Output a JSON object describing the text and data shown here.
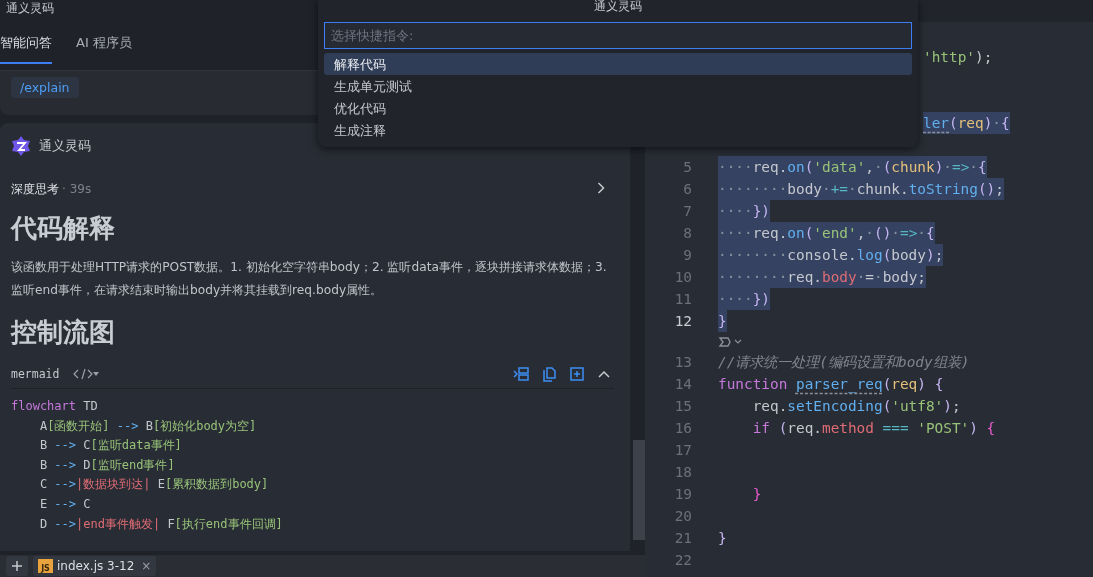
{
  "left_panel": {
    "title": "通义灵码",
    "tabs": [
      {
        "label": "智能问答",
        "selected": true
      },
      {
        "label": "AI 程序员",
        "selected": false
      }
    ],
    "prompt_chip": "/explain",
    "response": {
      "author": "通义灵码",
      "thinking": {
        "label": "深度思考",
        "duration": "· 39s"
      },
      "sections": [
        {
          "kind": "heading",
          "text": "代码解释"
        },
        {
          "kind": "paragraph",
          "text": "该函数用于处理HTTP请求的POST数据。1. 初始化空字符串body；2. 监听data事件，逐块拼接请求体数据；3. 监听end事件，在请求结束时输出body并将其挂载到req.body属性。"
        },
        {
          "kind": "heading",
          "text": "控制流图"
        }
      ],
      "code_block": {
        "language": "mermaid",
        "lines": [
          [
            {
              "text": "flowchart",
              "kind": "kw"
            },
            {
              "text": " TD",
              "kind": "plain"
            }
          ],
          [
            {
              "text": "    A",
              "kind": "plain"
            },
            {
              "text": "[函数开始]",
              "kind": "node"
            },
            {
              "text": " --> ",
              "kind": "arrow"
            },
            {
              "text": "B",
              "kind": "plain"
            },
            {
              "text": "[初始化body为空]",
              "kind": "node"
            }
          ],
          [
            {
              "text": "    B",
              "kind": "plain"
            },
            {
              "text": " --> ",
              "kind": "arrow"
            },
            {
              "text": "C",
              "kind": "plain"
            },
            {
              "text": "[监听data事件]",
              "kind": "node"
            }
          ],
          [
            {
              "text": "    B",
              "kind": "plain"
            },
            {
              "text": " --> ",
              "kind": "arrow"
            },
            {
              "text": "D",
              "kind": "plain"
            },
            {
              "text": "[监听end事件]",
              "kind": "node"
            }
          ],
          [
            {
              "text": "    C",
              "kind": "plain"
            },
            {
              "text": " -->",
              "kind": "arrow"
            },
            {
              "text": "|数据块到达|",
              "kind": "label"
            },
            {
              "text": " E",
              "kind": "plain"
            },
            {
              "text": "[累积数据到body]",
              "kind": "node"
            }
          ],
          [
            {
              "text": "    E",
              "kind": "plain"
            },
            {
              "text": " --> ",
              "kind": "arrow"
            },
            {
              "text": "C",
              "kind": "plain"
            }
          ],
          [
            {
              "text": "    D",
              "kind": "plain"
            },
            {
              "text": " -->",
              "kind": "arrow"
            },
            {
              "text": "|end事件触发|",
              "kind": "label"
            },
            {
              "text": " F",
              "kind": "plain"
            },
            {
              "text": "[执行end事件回调]",
              "kind": "node"
            }
          ]
        ]
      }
    },
    "bottom_tab": {
      "file_icon_label": "JS",
      "label": "index.js 3-12",
      "close": "×"
    }
  },
  "command_palette": {
    "title": "通义灵码",
    "placeholder": "选择快捷指令:",
    "items": [
      {
        "label": "解释代码",
        "selected": true
      },
      {
        "label": "生成单元测试",
        "selected": false
      },
      {
        "label": "优化代码",
        "selected": false
      },
      {
        "label": "生成注释",
        "selected": false
      }
    ]
  },
  "editor": {
    "rows": [
      {
        "kind": "partial",
        "selected": false,
        "tokens": [
          {
            "text": "'http'",
            "kind": "str"
          },
          {
            "text": ");",
            "kind": "plain"
          }
        ]
      },
      {
        "kind": "blank"
      },
      {
        "kind": "blank"
      },
      {
        "kind": "partial",
        "selected": true,
        "tokens": [
          {
            "text": "ler",
            "kind": "fndef"
          },
          {
            "text": "(",
            "kind": "bracket"
          },
          {
            "text": "req",
            "kind": "param"
          },
          {
            "text": ")",
            "kind": "bracket"
          },
          {
            "text": "·",
            "kind": "ws"
          },
          {
            "text": "{",
            "kind": "bracket"
          }
        ]
      },
      {
        "kind": "blank"
      },
      {
        "kind": "code",
        "number": "5",
        "selected": true,
        "current": false,
        "tokens": [
          {
            "text": "····",
            "kind": "ws"
          },
          {
            "text": "req.",
            "kind": "plain"
          },
          {
            "text": "on",
            "kind": "fn"
          },
          {
            "text": "(",
            "kind": "bracket"
          },
          {
            "text": "'data'",
            "kind": "str"
          },
          {
            "text": ",",
            "kind": "plain"
          },
          {
            "text": "·",
            "kind": "ws"
          },
          {
            "text": "(",
            "kind": "bracket"
          },
          {
            "text": "chunk",
            "kind": "param"
          },
          {
            "text": ")",
            "kind": "bracket"
          },
          {
            "text": "·",
            "kind": "ws"
          },
          {
            "text": "=>",
            "kind": "op"
          },
          {
            "text": "·",
            "kind": "ws"
          },
          {
            "text": "{",
            "kind": "bracket"
          }
        ]
      },
      {
        "kind": "code",
        "number": "6",
        "selected": true,
        "current": false,
        "tokens": [
          {
            "text": "········",
            "kind": "ws"
          },
          {
            "text": "body",
            "kind": "plain"
          },
          {
            "text": "·",
            "kind": "ws"
          },
          {
            "text": "+=",
            "kind": "op"
          },
          {
            "text": "·",
            "kind": "ws"
          },
          {
            "text": "chunk.",
            "kind": "plain"
          },
          {
            "text": "toString",
            "kind": "fn"
          },
          {
            "text": "()",
            "kind": "bracket"
          },
          {
            "text": ";",
            "kind": "plain"
          }
        ]
      },
      {
        "kind": "code",
        "number": "7",
        "selected": true,
        "current": false,
        "tokens": [
          {
            "text": "····",
            "kind": "ws"
          },
          {
            "text": "})",
            "kind": "bracket"
          }
        ]
      },
      {
        "kind": "code",
        "number": "8",
        "selected": true,
        "current": false,
        "tokens": [
          {
            "text": "····",
            "kind": "ws"
          },
          {
            "text": "req.",
            "kind": "plain"
          },
          {
            "text": "on",
            "kind": "fn"
          },
          {
            "text": "(",
            "kind": "bracket"
          },
          {
            "text": "'end'",
            "kind": "str"
          },
          {
            "text": ",",
            "kind": "plain"
          },
          {
            "text": "·",
            "kind": "ws"
          },
          {
            "text": "()",
            "kind": "bracket"
          },
          {
            "text": "·",
            "kind": "ws"
          },
          {
            "text": "=>",
            "kind": "op"
          },
          {
            "text": "·",
            "kind": "ws"
          },
          {
            "text": "{",
            "kind": "bracket"
          }
        ]
      },
      {
        "kind": "code",
        "number": "9",
        "selected": true,
        "current": false,
        "tokens": [
          {
            "text": "········",
            "kind": "ws"
          },
          {
            "text": "console.",
            "kind": "plain"
          },
          {
            "text": "log",
            "kind": "fn"
          },
          {
            "text": "(",
            "kind": "bracket"
          },
          {
            "text": "body",
            "kind": "plain"
          },
          {
            "text": ")",
            "kind": "bracket"
          },
          {
            "text": ";",
            "kind": "plain"
          }
        ]
      },
      {
        "kind": "code",
        "number": "10",
        "selected": true,
        "current": false,
        "tokens": [
          {
            "text": "········",
            "kind": "ws"
          },
          {
            "text": "req.",
            "kind": "plain"
          },
          {
            "text": "body",
            "kind": "prop"
          },
          {
            "text": "·",
            "kind": "ws"
          },
          {
            "text": "=",
            "kind": "plain"
          },
          {
            "text": "·",
            "kind": "ws"
          },
          {
            "text": "body;",
            "kind": "plain"
          }
        ]
      },
      {
        "kind": "code",
        "number": "11",
        "selected": true,
        "current": false,
        "tokens": [
          {
            "text": "····",
            "kind": "ws"
          },
          {
            "text": "})",
            "kind": "bracket"
          }
        ]
      },
      {
        "kind": "code",
        "number": "12",
        "selected": true,
        "current": true,
        "tokens": [
          {
            "text": "}",
            "kind": "bracket"
          }
        ]
      },
      {
        "kind": "fold"
      },
      {
        "kind": "code",
        "number": "13",
        "selected": false,
        "current": false,
        "tokens": [
          {
            "text": "//请求统一处理(编码设置和body组装)",
            "kind": "comment"
          }
        ]
      },
      {
        "kind": "code",
        "number": "14",
        "selected": false,
        "current": false,
        "tokens": [
          {
            "text": "function ",
            "kind": "kw"
          },
          {
            "text": "parser_req",
            "kind": "fndef"
          },
          {
            "text": "(",
            "kind": "bracket"
          },
          {
            "text": "req",
            "kind": "param"
          },
          {
            "text": ")",
            "kind": "bracket"
          },
          {
            "text": " {",
            "kind": "bracket"
          }
        ]
      },
      {
        "kind": "code",
        "number": "15",
        "selected": false,
        "current": false,
        "tokens": [
          {
            "text": "    req.",
            "kind": "plain"
          },
          {
            "text": "setEncoding",
            "kind": "fn"
          },
          {
            "text": "(",
            "kind": "bracket"
          },
          {
            "text": "'utf8'",
            "kind": "str"
          },
          {
            "text": ")",
            "kind": "bracket"
          },
          {
            "text": ";",
            "kind": "plain"
          }
        ]
      },
      {
        "kind": "code",
        "number": "16",
        "selected": false,
        "current": false,
        "tokens": [
          {
            "text": "    if",
            "kind": "kw"
          },
          {
            "text": " (",
            "kind": "bracket"
          },
          {
            "text": "req.",
            "kind": "plain"
          },
          {
            "text": "method",
            "kind": "prop"
          },
          {
            "text": " ===",
            "kind": "op"
          },
          {
            "text": " 'POST'",
            "kind": "str"
          },
          {
            "text": ")",
            "kind": "bracket"
          },
          {
            "text": " {",
            "kind": "brace2"
          }
        ]
      },
      {
        "kind": "code",
        "number": "17",
        "current": false,
        "tokens": []
      },
      {
        "kind": "code",
        "number": "18",
        "current": false,
        "tokens": []
      },
      {
        "kind": "code",
        "number": "19",
        "selected": false,
        "current": false,
        "tokens": [
          {
            "text": "    }",
            "kind": "brace2"
          }
        ]
      },
      {
        "kind": "code",
        "number": "20",
        "current": false,
        "tokens": []
      },
      {
        "kind": "code",
        "number": "21",
        "selected": false,
        "current": false,
        "tokens": [
          {
            "text": "}",
            "kind": "bracket"
          }
        ]
      },
      {
        "kind": "code",
        "number": "22",
        "current": false,
        "tokens": []
      }
    ]
  }
}
